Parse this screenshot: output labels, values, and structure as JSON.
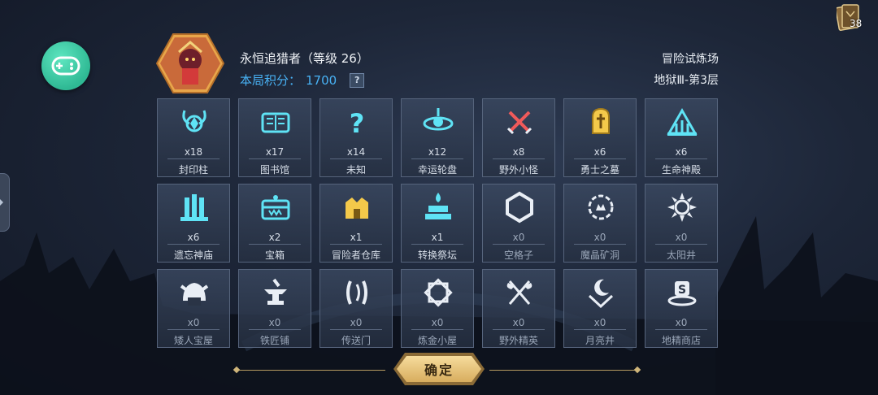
{
  "player": {
    "name": "永恒追猎者（等级 26）",
    "score_label": "本局积分：",
    "score_value": "1700",
    "help": "?"
  },
  "mode": {
    "title": "冒险试炼场",
    "floor": "地狱Ⅲ-第3层"
  },
  "deck_count": "38",
  "tiles": [
    {
      "label": "封印柱",
      "count": "x18",
      "icon": "seal-pillar-icon"
    },
    {
      "label": "图书馆",
      "count": "x17",
      "icon": "library-book-icon"
    },
    {
      "label": "未知",
      "count": "x14",
      "icon": "question-mark-icon"
    },
    {
      "label": "幸运轮盘",
      "count": "x12",
      "icon": "lucky-wheel-icon"
    },
    {
      "label": "野外小怪",
      "count": "x8",
      "icon": "crossed-swords-icon"
    },
    {
      "label": "勇士之墓",
      "count": "x6",
      "icon": "tombstone-icon"
    },
    {
      "label": "生命神殿",
      "count": "x6",
      "icon": "life-temple-icon"
    },
    {
      "label": "遗忘神庙",
      "count": "x6",
      "icon": "forgotten-temple-icon"
    },
    {
      "label": "宝箱",
      "count": "x2",
      "icon": "treasure-chest-icon"
    },
    {
      "label": "冒险者仓库",
      "count": "x1",
      "icon": "warehouse-icon"
    },
    {
      "label": "转换祭坛",
      "count": "x1",
      "icon": "altar-icon"
    },
    {
      "label": "空格子",
      "count": "x0",
      "icon": "empty-hexagon-icon"
    },
    {
      "label": "魔晶矿洞",
      "count": "x0",
      "icon": "crystal-mine-icon"
    },
    {
      "label": "太阳井",
      "count": "x0",
      "icon": "sun-well-icon"
    },
    {
      "label": "矮人宝屋",
      "count": "x0",
      "icon": "dwarf-helmet-icon"
    },
    {
      "label": "铁匠铺",
      "count": "x0",
      "icon": "anvil-icon"
    },
    {
      "label": "传送门",
      "count": "x0",
      "icon": "portal-icon"
    },
    {
      "label": "炼金小屋",
      "count": "x0",
      "icon": "alchemy-star-icon"
    },
    {
      "label": "野外精英",
      "count": "x0",
      "icon": "crossed-axes-icon"
    },
    {
      "label": "月亮井",
      "count": "x0",
      "icon": "moon-well-icon"
    },
    {
      "label": "地精商店",
      "count": "x0",
      "icon": "goblin-shop-icon"
    }
  ],
  "confirm_label": "确定",
  "colors": {
    "accent_blue": "#48b2f5",
    "icon_cyan": "#5fe3f5",
    "icon_gold": "#f4c94a",
    "game_button": "#2fb994"
  }
}
